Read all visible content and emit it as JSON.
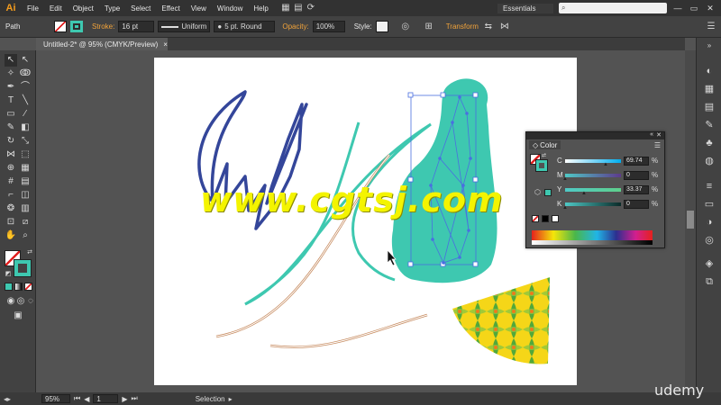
{
  "app": {
    "logo": "Ai",
    "menus": [
      "File",
      "Edit",
      "Object",
      "Type",
      "Select",
      "Effect",
      "View",
      "Window",
      "Help"
    ],
    "workspace": "Essentials",
    "window_controls": [
      "—",
      "▭",
      "✕"
    ]
  },
  "control_bar": {
    "selection_type": "Path",
    "fill_color": "#ffffff",
    "stroke_color": "#3ec8b0",
    "stroke_label": "Stroke:",
    "stroke_weight": "16 pt",
    "profile": "Uniform",
    "brush": "5 pt. Round",
    "opacity_label": "Opacity:",
    "opacity_value": "100%",
    "style_label": "Style:",
    "transform_label": "Transform"
  },
  "document": {
    "tab_title": "Untitled-2* @ 95% (CMYK/Preview)",
    "close": "×"
  },
  "color_panel": {
    "tab_label": "Color",
    "channels": [
      {
        "letter": "C",
        "value": "69.74",
        "gradient": "linear-gradient(90deg,#fff,#00aeef)",
        "thumb": 0.7
      },
      {
        "letter": "M",
        "value": "0",
        "gradient": "linear-gradient(90deg,#fff,#ec008c)",
        "thumb": 0.0
      },
      {
        "letter": "Y",
        "value": "33.37",
        "gradient": "linear-gradient(90deg,#4fc9c6,#5fd08c)",
        "thumb": 0.33
      },
      {
        "letter": "K",
        "value": "0",
        "gradient": "linear-gradient(90deg,#4fc9c6,#0a2a28)",
        "thumb": 0.0
      }
    ],
    "percent": "%",
    "current_color": "#3ec8b0"
  },
  "status_bar": {
    "zoom": "95%",
    "artboard": "1",
    "tool": "Selection"
  },
  "watermark": "www.cgtsj.com",
  "branding": "udemy",
  "colors": {
    "teal": "#3ec8b0",
    "navy": "#34469a",
    "guide_blue": "#4a6fe0"
  }
}
